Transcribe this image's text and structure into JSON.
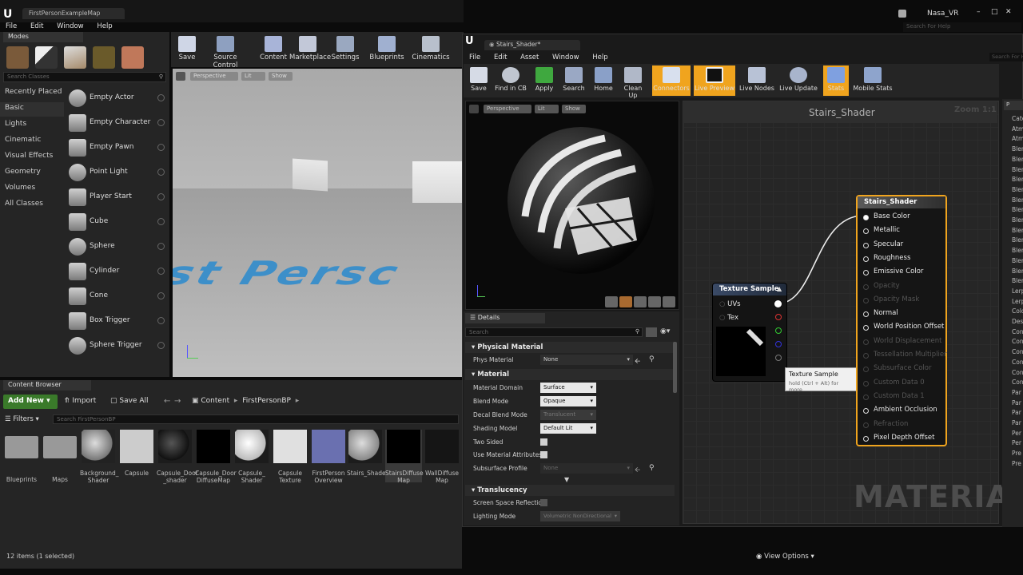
{
  "window": {
    "tab_title": "FirstPersonExampleMap",
    "user": "Nasa_VR",
    "help_search_placeholder": "Search For Help"
  },
  "menu": [
    "File",
    "Edit",
    "Window",
    "Help"
  ],
  "modes": {
    "tab": "Modes",
    "search_placeholder": "Search Classes",
    "categories": [
      "Recently Placed",
      "Basic",
      "Lights",
      "Cinematic",
      "Visual Effects",
      "Geometry",
      "Volumes",
      "All Classes"
    ],
    "selected_category": "Basic",
    "classes": [
      "Empty Actor",
      "Empty Character",
      "Empty Pawn",
      "Point Light",
      "Player Start",
      "Cube",
      "Sphere",
      "Cylinder",
      "Cone",
      "Box Trigger",
      "Sphere Trigger"
    ]
  },
  "main_toolbar": [
    "Save",
    "Source Control",
    "Content",
    "Marketplace",
    "Settings",
    "Blueprints",
    "Cinematics"
  ],
  "viewport": {
    "perspective": "Perspective",
    "lit": "Lit",
    "show": "Show",
    "floor_text": "st Persc"
  },
  "content_browser": {
    "tab": "Content Browser",
    "add_new": "Add New",
    "import": "Import",
    "save_all": "Save All",
    "path": [
      "Content",
      "FirstPersonBP"
    ],
    "filters": "Filters",
    "search_placeholder": "Search FirstPersonBP",
    "assets": [
      {
        "name": "Blueprints"
      },
      {
        "name": "Maps"
      },
      {
        "name": "Background_ Shader"
      },
      {
        "name": "Capsule"
      },
      {
        "name": "Capsule_Door _shader"
      },
      {
        "name": "Capsule_Door DiffuseMap"
      },
      {
        "name": "Capsule_ Shader"
      },
      {
        "name": "Capsule Texture"
      },
      {
        "name": "FirstPerson Overview"
      },
      {
        "name": "Stairs_Shader"
      },
      {
        "name": "StairsDiffuse Map"
      },
      {
        "name": "WallDiffuse Map"
      }
    ],
    "status": "12 items (1 selected)",
    "view_options": "View Options"
  },
  "material_editor": {
    "tab": "Stairs_Shader*",
    "menu": [
      "File",
      "Edit",
      "Asset",
      "Window",
      "Help"
    ],
    "search_placeholder": "Search For Help",
    "toolbar": [
      "Save",
      "Find in CB",
      "Apply",
      "Search",
      "Home",
      "Clean Up",
      "Connectors",
      "Live Preview",
      "Live Nodes",
      "Live Update",
      "Stats",
      "Mobile Stats"
    ],
    "preview": {
      "perspective": "Perspective",
      "lit": "Lit",
      "show": "Show"
    },
    "details": {
      "tab": "Details",
      "search_placeholder": "Search",
      "sections": [
        "Physical Material",
        "Material",
        "Translucency"
      ],
      "phys_material": {
        "label": "Phys Material",
        "value": "None"
      },
      "material_domain": {
        "label": "Material Domain",
        "value": "Surface"
      },
      "blend_mode": {
        "label": "Blend Mode",
        "value": "Opaque"
      },
      "decal_blend_mode": {
        "label": "Decal Blend Mode",
        "value": "Translucent"
      },
      "shading_model": {
        "label": "Shading Model",
        "value": "Default Lit"
      },
      "two_sided": "Two Sided",
      "use_material_attributes": "Use Material Attributes",
      "subsurface_profile": {
        "label": "Subsurface Profile",
        "value": "None"
      },
      "screen_space_reflections": "Screen Space Reflectio",
      "lighting_mode": {
        "label": "Lighting Mode",
        "value": "Volumetric NonDirectional"
      }
    },
    "graph": {
      "title": "Stairs_Shader",
      "zoom": "Zoom 1:1",
      "watermark": "MATERIAL",
      "texture_node": {
        "title": "Texture Sample",
        "pins": [
          "UVs",
          "Tex"
        ]
      },
      "tooltip": {
        "title": "Texture Sample",
        "hint": "hold (Ctrl + Alt) for more"
      },
      "result_node": {
        "title": "Stairs_Shader",
        "pins": [
          {
            "label": "Base Color",
            "enabled": true
          },
          {
            "label": "Metallic",
            "enabled": true
          },
          {
            "label": "Specular",
            "enabled": true
          },
          {
            "label": "Roughness",
            "enabled": true
          },
          {
            "label": "Emissive Color",
            "enabled": true
          },
          {
            "label": "Opacity",
            "enabled": false
          },
          {
            "label": "Opacity Mask",
            "enabled": false
          },
          {
            "label": "Normal",
            "enabled": true
          },
          {
            "label": "World Position Offset",
            "enabled": true
          },
          {
            "label": "World Displacement",
            "enabled": false
          },
          {
            "label": "Tessellation Multiplier",
            "enabled": false
          },
          {
            "label": "Subsurface Color",
            "enabled": false
          },
          {
            "label": "Custom Data 0",
            "enabled": false
          },
          {
            "label": "Custom Data 1",
            "enabled": false
          },
          {
            "label": "Ambient Occlusion",
            "enabled": true
          },
          {
            "label": "Refraction",
            "enabled": false
          },
          {
            "label": "Pixel Depth Offset",
            "enabled": true
          }
        ]
      }
    },
    "palette": {
      "items": [
        "Catego",
        "Atmo",
        "Atm",
        "Blen",
        "Blen",
        "Blen",
        "Blen",
        "Blen",
        "Blen",
        "Blen",
        "Blen",
        "Blen",
        "Blen",
        "Blen",
        "Blen",
        "Blen",
        "Blen",
        "Lerp",
        "Lerp",
        "Colo",
        "Des",
        "Con",
        "Con",
        "Con",
        "Con",
        "Con",
        "Con",
        "Par",
        "Par",
        "Par",
        "Par",
        "Per",
        "Per",
        "Pre",
        "Pre"
      ]
    }
  },
  "colors": {
    "accent": "#f0a41e",
    "selected_category_bg": "#303030",
    "add_new_green": "#3a7a2a"
  }
}
